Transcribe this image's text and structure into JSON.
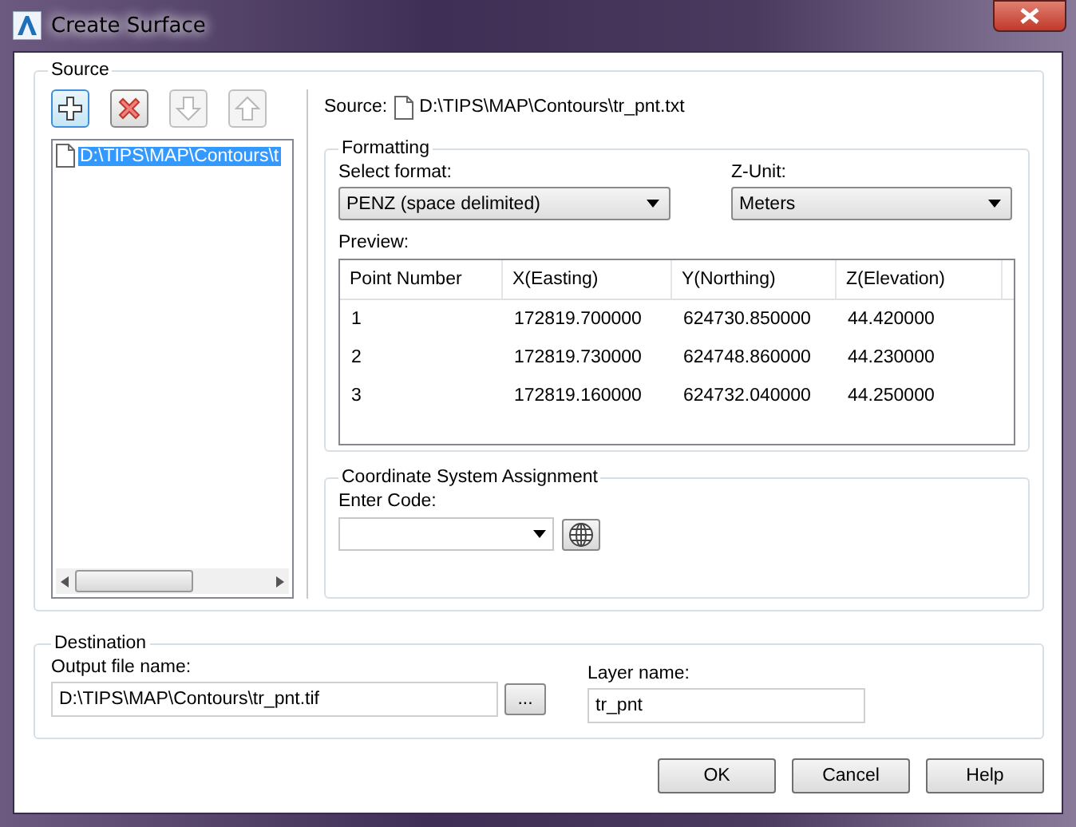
{
  "window": {
    "title": "Create Surface"
  },
  "source": {
    "group_label": "Source",
    "toolbar": [
      {
        "kind": "add",
        "disabled": false,
        "focused": true
      },
      {
        "kind": "remove",
        "disabled": false,
        "focused": false
      },
      {
        "kind": "down",
        "disabled": true,
        "focused": false
      },
      {
        "kind": "up",
        "disabled": true,
        "focused": false
      }
    ],
    "files": [
      {
        "label": "D:\\TIPS\\MAP\\Contours\\t",
        "selected": true
      }
    ],
    "source_label": "Source:",
    "source_path": "D:\\TIPS\\MAP\\Contours\\tr_pnt.txt"
  },
  "formatting": {
    "group_label": "Formatting",
    "format_label": "Select format:",
    "format_value": "PENZ (space delimited)",
    "zunit_label": "Z-Unit:",
    "zunit_value": "Meters",
    "preview_label": "Preview:",
    "table": {
      "columns": [
        "Point Number",
        "X(Easting)",
        "Y(Northing)",
        "Z(Elevation)"
      ],
      "rows": [
        [
          "1",
          "172819.700000",
          "624730.850000",
          "44.420000"
        ],
        [
          "2",
          "172819.730000",
          "624748.860000",
          "44.230000"
        ],
        [
          "3",
          "172819.160000",
          "624732.040000",
          "44.250000"
        ]
      ]
    }
  },
  "coordinate_system": {
    "group_label": "Coordinate System Assignment",
    "code_label": "Enter Code:"
  },
  "destination": {
    "group_label": "Destination",
    "output_label": "Output file name:",
    "output_value": "D:\\TIPS\\MAP\\Contours\\tr_pnt.tif",
    "browse": "...",
    "layer_label": "Layer name:",
    "layer_value": "tr_pnt"
  },
  "buttons": [
    "OK",
    "Cancel",
    "Help"
  ]
}
